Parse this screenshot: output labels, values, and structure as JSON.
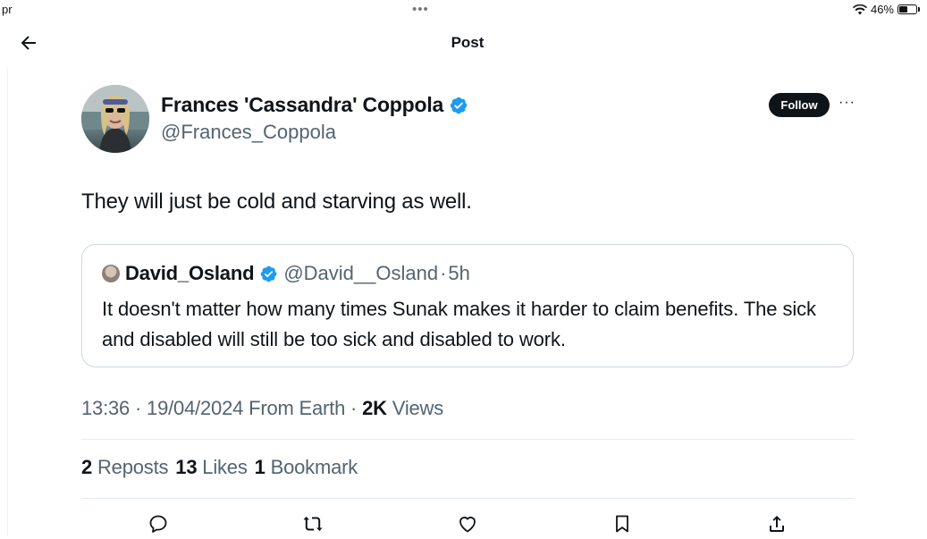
{
  "status_bar": {
    "left_text": "pr",
    "battery": "46%"
  },
  "header": {
    "title": "Post"
  },
  "tweet": {
    "author_name": "Frances 'Cassandra' Coppola",
    "author_handle": "@Frances_Coppola",
    "follow_label": "Follow",
    "more_label": "···",
    "text": "They will just be cold and starving as well.",
    "quoted": {
      "name": "David_Osland",
      "handle": "@David__Osland",
      "separator": "·",
      "time": "5h",
      "text": "It doesn't matter how many times Sunak makes it harder to claim benefits. The sick and disabled will still be too sick and disabled to work."
    },
    "meta": {
      "time": "13:36",
      "dot1": "·",
      "date": "19/04/2024",
      "location": "From Earth",
      "dot2": "·",
      "views_count": "2K",
      "views_label": "Views"
    },
    "stats": {
      "reposts_count": "2",
      "reposts_label": "Reposts",
      "likes_count": "13",
      "likes_label": "Likes",
      "bookmarks_count": "1",
      "bookmarks_label": "Bookmark"
    }
  },
  "colors": {
    "text": "#0f1419",
    "secondary": "#536471",
    "verified": "#1d9bf0",
    "border": "#cfd9de"
  }
}
